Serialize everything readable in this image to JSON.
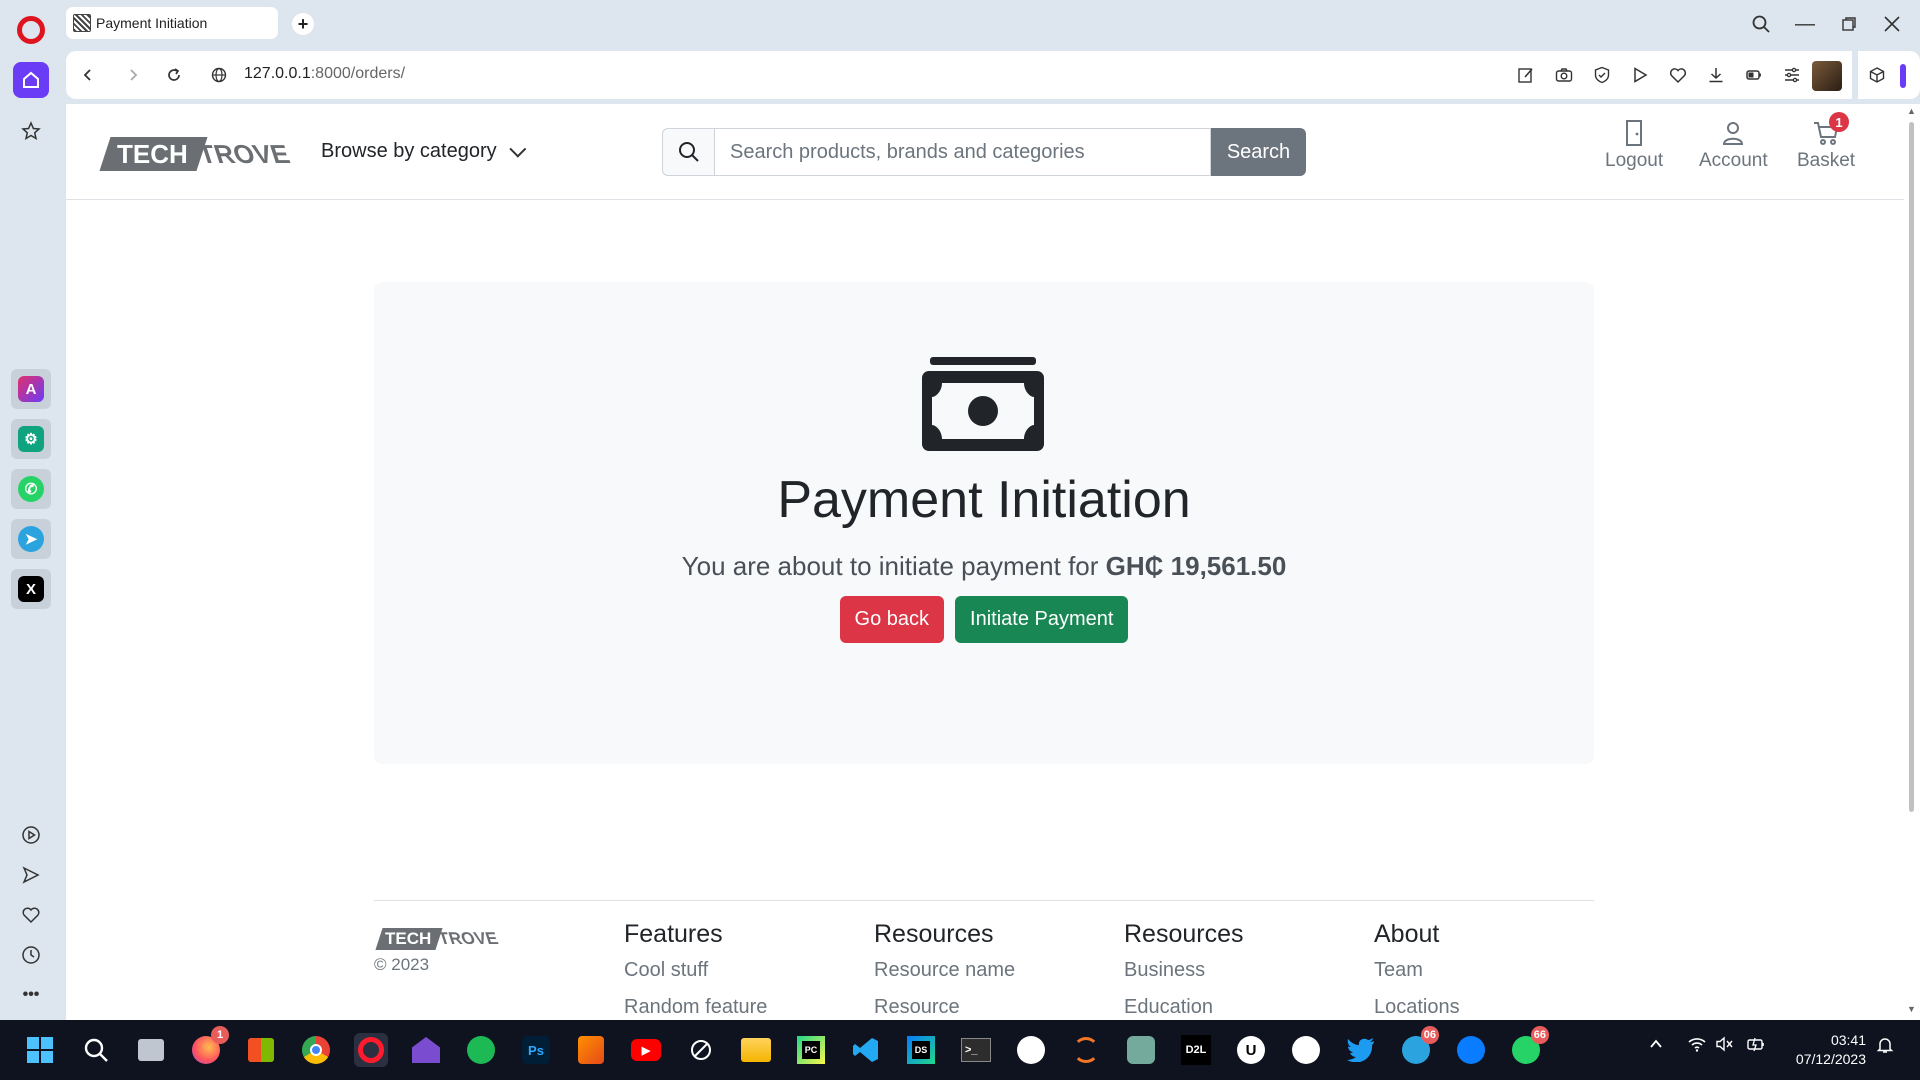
{
  "browser": {
    "tab_title": "Payment Initiation",
    "url_host": "127.0.0.1",
    "url_rest": ":8000/orders/"
  },
  "header": {
    "logo_tech": "TECH",
    "logo_trove": "TROVE",
    "browse_label": "Browse by category",
    "search_placeholder": "Search products, brands and categories",
    "search_button": "Search",
    "actions": {
      "logout": "Logout",
      "account": "Account",
      "basket": "Basket",
      "basket_count": "1"
    }
  },
  "payment": {
    "title": "Payment Initiation",
    "lead_text": "You are about to initiate payment for",
    "amount": "GH₵ 19,561.50",
    "go_back": "Go back",
    "initiate": "Initiate Payment"
  },
  "footer": {
    "logo_tech": "TECH",
    "logo_trove": "TROVE",
    "copyright": "© 2023",
    "columns": [
      {
        "heading": "Features",
        "links": [
          "Cool stuff",
          "Random feature"
        ]
      },
      {
        "heading": "Resources",
        "links": [
          "Resource name",
          "Resource"
        ]
      },
      {
        "heading": "Resources",
        "links": [
          "Business",
          "Education"
        ]
      },
      {
        "heading": "About",
        "links": [
          "Team",
          "Locations"
        ]
      }
    ]
  },
  "taskbar": {
    "badges": {
      "firefox": "1",
      "telegram": "06",
      "whatsapp": "66"
    },
    "time": "03:41",
    "date": "07/12/2023"
  }
}
